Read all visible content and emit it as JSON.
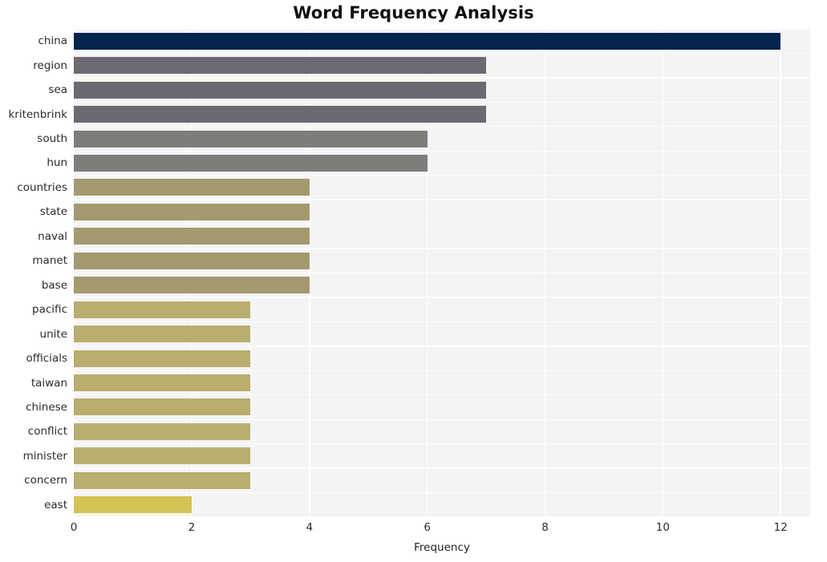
{
  "chart_data": {
    "type": "bar",
    "orientation": "horizontal",
    "title": "Word Frequency Analysis",
    "xlabel": "Frequency",
    "ylabel": "",
    "xlim": [
      0,
      12.5
    ],
    "xticks": [
      0,
      2,
      4,
      6,
      8,
      10,
      12
    ],
    "xtick_labels": [
      "0",
      "2",
      "4",
      "6",
      "8",
      "10",
      "12"
    ],
    "grid": true,
    "legend": null,
    "categories": [
      "china",
      "region",
      "sea",
      "kritenbrink",
      "south",
      "hun",
      "countries",
      "state",
      "naval",
      "manet",
      "base",
      "pacific",
      "unite",
      "officials",
      "taiwan",
      "chinese",
      "conflict",
      "minister",
      "concern",
      "east"
    ],
    "values": [
      12,
      7,
      7,
      7,
      6,
      6,
      4,
      4,
      4,
      4,
      4,
      3,
      3,
      3,
      3,
      3,
      3,
      3,
      3,
      2
    ],
    "bar_colors": [
      "#04254e",
      "#6a6a73",
      "#6a6a73",
      "#6a6a73",
      "#7d7d7a",
      "#7d7d7a",
      "#a39a70",
      "#a39a70",
      "#a39a70",
      "#a39a70",
      "#a39a70",
      "#b9ae6e",
      "#b9ae6e",
      "#b9ae6e",
      "#b9ae6e",
      "#b9ae6e",
      "#b9ae6e",
      "#b9ae6e",
      "#b9ae6e",
      "#d3c354"
    ],
    "colormap": "cividis",
    "plot_background": "#f4f4f5",
    "gridline_color": "#fdfdfd",
    "title_color": "#111111",
    "tick_color": "#2b2b2b"
  }
}
